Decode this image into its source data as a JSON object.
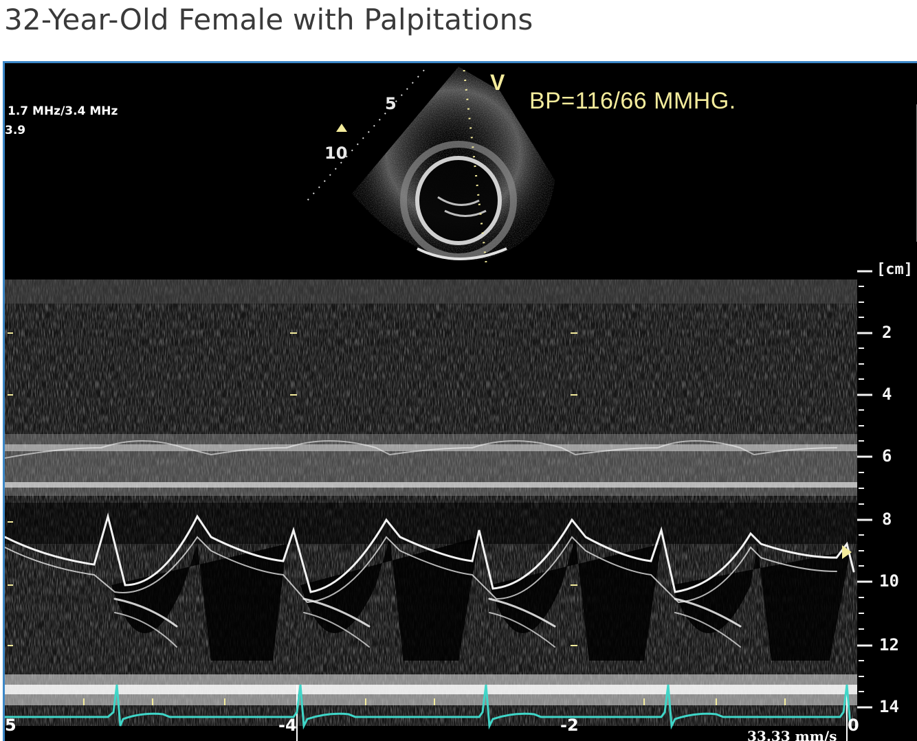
{
  "title": "32-Year-Old Female with Palpitations",
  "overlay": {
    "frequency": "1.7 MHz/3.4 MHz",
    "gain": "3.9",
    "bp": "BP=116/66 MMHG.",
    "v_marker": "V",
    "sector_depth_5": "5",
    "sector_depth_10": "10",
    "speed": "33.33 mm/s"
  },
  "depth_scale": {
    "unit": "[cm]",
    "labels": [
      "2",
      "4",
      "6",
      "8",
      "10",
      "12",
      "14"
    ]
  },
  "time_axis": {
    "labels": [
      "5",
      "-4",
      "-2",
      "0"
    ]
  },
  "colors": {
    "frame_border": "#3b87c8",
    "ecg_trace": "#3fd6c8",
    "annotation_yellow": "#f4ec9c",
    "background": "#000000"
  }
}
